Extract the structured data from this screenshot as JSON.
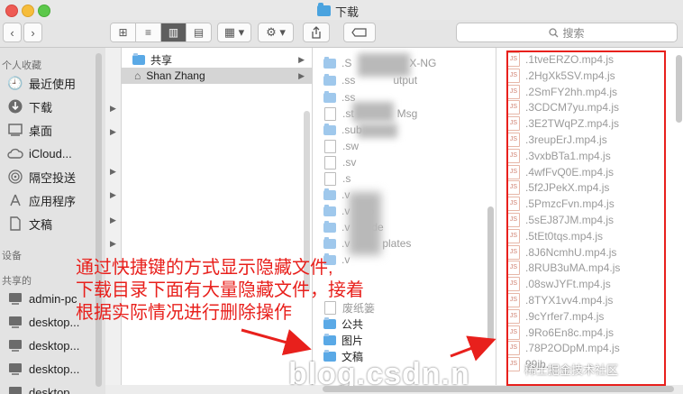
{
  "window": {
    "title": "下载"
  },
  "toolbar": {
    "back": "‹",
    "forward": "›",
    "view_icons": [
      "⊞",
      "≡",
      "▥",
      "▤"
    ],
    "arrange": "▦ ▾",
    "action": "⚙ ▾",
    "search_placeholder": "搜索"
  },
  "sidebar": {
    "favorites_header": "个人收藏",
    "favorites": [
      {
        "label": "最近使用",
        "icon": "clock-icon"
      },
      {
        "label": "下载",
        "icon": "download-icon"
      },
      {
        "label": "桌面",
        "icon": "desktop-icon"
      },
      {
        "label": "iCloud...",
        "icon": "cloud-icon"
      },
      {
        "label": "隔空投送",
        "icon": "airdrop-icon"
      },
      {
        "label": "应用程序",
        "icon": "apps-icon"
      },
      {
        "label": "文稿",
        "icon": "document-icon"
      }
    ],
    "devices_header": "设备",
    "shared_header": "共享的",
    "shared": [
      "admin-pc",
      "desktop...",
      "desktop...",
      "desktop...",
      "desktop..."
    ]
  },
  "column2": {
    "items": [
      "共享",
      "Shan Zhang"
    ]
  },
  "column3": {
    "items": [
      ".S",
      "X-NG",
      ".ss",
      "utput",
      ".ss",
      ".st",
      "Msg",
      ".sub",
      ".sw",
      ".sv",
      ".s",
      ".v",
      ".v",
      "o",
      ".v",
      "de",
      ".v",
      "plates",
      ".v",
      "废纸篓",
      "公共",
      "图片",
      "文稿"
    ]
  },
  "column4": {
    "files": [
      ".1tveERZO.mp4.js",
      ".2HgXk5SV.mp4.js",
      ".2SmFY2hh.mp4.js",
      ".3CDCM7yu.mp4.js",
      ".3E2TWqPZ.mp4.js",
      ".3reupErJ.mp4.js",
      ".3vxbBTa1.mp4.js",
      ".4wfFvQ0E.mp4.js",
      ".5f2JPekX.mp4.js",
      ".5PmzcFvn.mp4.js",
      ".5sEJ87JM.mp4.js",
      ".5tEt0tqs.mp4.js",
      ".8J6NcmhU.mp4.js",
      ".8RUB3uMA.mp4.js",
      ".08swJYFt.mp4.js",
      ".8TYX1vv4.mp4.js",
      ".9cYrfer7.mp4.js",
      ".9Ro6En8c.mp4.js",
      ".78P2ODpM.mp4.js",
      "99jb..."
    ]
  },
  "annotation": {
    "lines": [
      "通过快捷键的方式显示隐藏文件,",
      "下载目录下面有大量隐藏文件，接着",
      "根据实际情况进行删除操作"
    ]
  },
  "watermark": {
    "text": "blog.csdn.n",
    "text2": "稀土掘金技术社区"
  }
}
